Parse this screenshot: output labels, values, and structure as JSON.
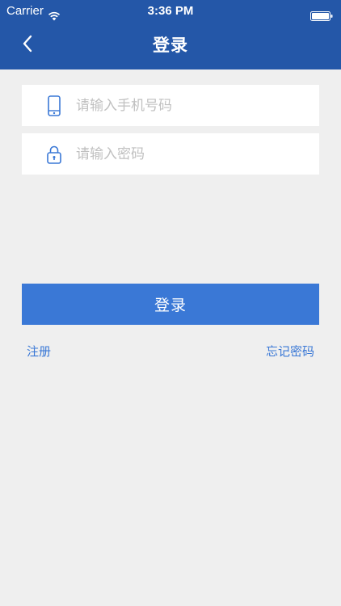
{
  "status_bar": {
    "carrier": "Carrier",
    "time": "3:36 PM"
  },
  "nav": {
    "title": "登录"
  },
  "form": {
    "phone_placeholder": "请输入手机号码",
    "password_placeholder": "请输入密码",
    "login_label": "登录",
    "register_label": "注册",
    "forgot_label": "忘记密码"
  },
  "colors": {
    "header_bg": "#2457a8",
    "primary": "#3a78d6",
    "background": "#efefef"
  },
  "icons": {
    "back": "chevron-left-icon",
    "phone": "phone-icon",
    "lock": "lock-icon"
  }
}
